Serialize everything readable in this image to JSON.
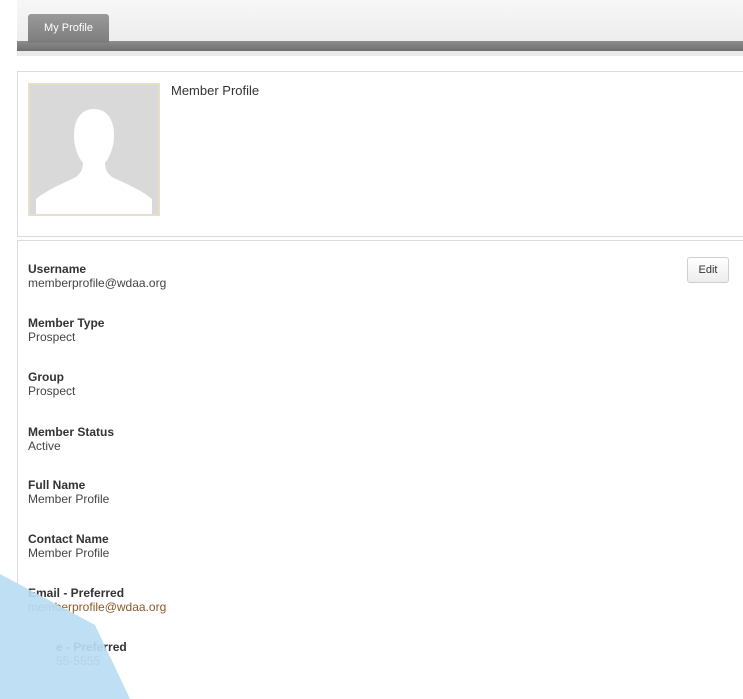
{
  "tabs": [
    {
      "label": "My Profile"
    }
  ],
  "profile": {
    "name": "Member Profile"
  },
  "actions": {
    "edit_label": "Edit"
  },
  "fields": [
    {
      "label": "Username",
      "value": "memberprofile@wdaa.org"
    },
    {
      "label": "Member Type",
      "value": "Prospect"
    },
    {
      "label": "Group",
      "value": "Prospect"
    },
    {
      "label": "Member Status",
      "value": "Active"
    },
    {
      "label": "Full Name",
      "value": "Member Profile"
    },
    {
      "label": "Contact Name",
      "value": "Member Profile"
    },
    {
      "label": "Email - Preferred",
      "value": "memberprofile@wdaa.org"
    },
    {
      "label": "e - Preferred",
      "value": "55-5555"
    }
  ],
  "colors": {
    "link": "#8a5a2b",
    "overlay": "#b9dcf3",
    "tab": "#8a8a8a"
  },
  "icons": {
    "avatar": "person-silhouette-icon"
  }
}
